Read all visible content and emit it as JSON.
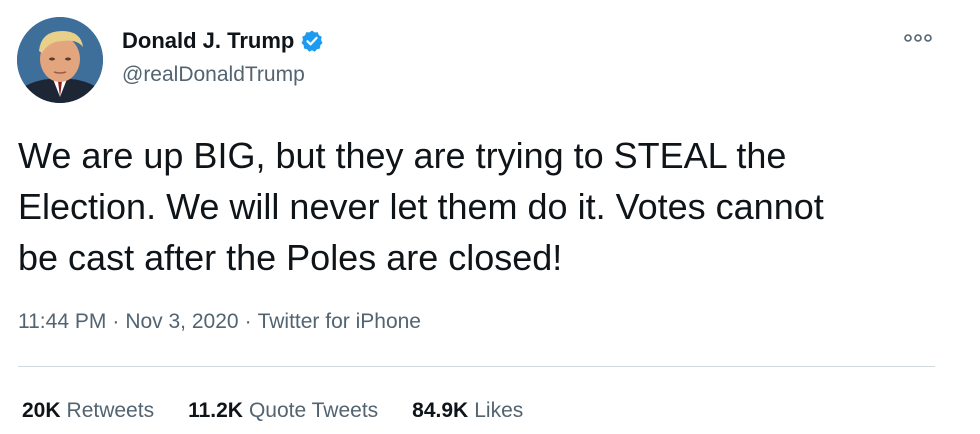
{
  "author": {
    "name": "Donald J. Trump",
    "handle": "@realDonaldTrump",
    "verified": true
  },
  "tweet": {
    "text": "We are up BIG, but they are trying to STEAL the\nElection. We will never let them do it. Votes cannot\nbe cast after the Poles are closed!"
  },
  "meta": {
    "time": "11:44 PM",
    "separator": "·",
    "date": "Nov 3, 2020",
    "source": "Twitter for iPhone"
  },
  "stats": {
    "retweets_value": "20K",
    "retweets_label": "Retweets",
    "quote_value": "11.2K",
    "quote_label": "Quote Tweets",
    "likes_value": "84.9K",
    "likes_label": "Likes"
  },
  "colors": {
    "verified_blue": "#1d9bf0",
    "secondary_text": "#536471",
    "primary_text": "#0f1419",
    "divider": "#cfd9de"
  },
  "icons": {
    "verified": "verified-badge-icon",
    "more": "more-options-icon"
  }
}
